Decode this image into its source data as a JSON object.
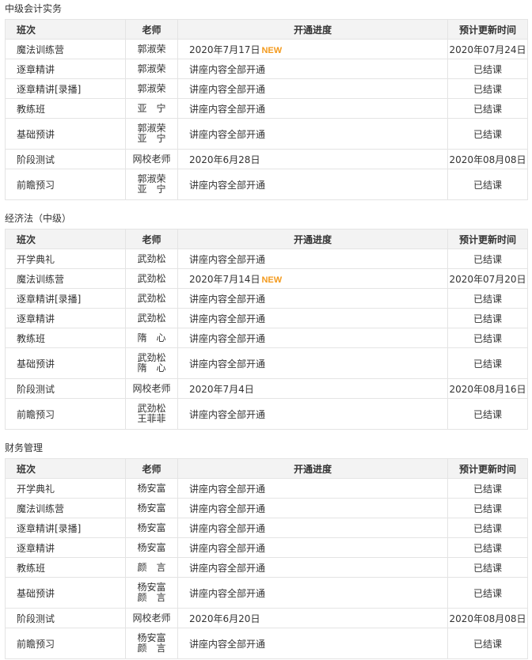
{
  "headers": {
    "name": "班次",
    "teacher": "老师",
    "progress": "开通进度",
    "update": "预计更新时间"
  },
  "sections": [
    {
      "title": "中级会计实务",
      "rows": [
        {
          "name": "魔法训练营",
          "teachers": [
            "郭淑荣"
          ],
          "progress": "2020年7月17日",
          "badge": "NEW",
          "update": "2020年07月24日"
        },
        {
          "name": "逐章精讲",
          "teachers": [
            "郭淑荣"
          ],
          "progress": "讲座内容全部开通",
          "badge": "",
          "update": "已结课"
        },
        {
          "name": "逐章精讲[录播]",
          "teachers": [
            "郭淑荣"
          ],
          "progress": "讲座内容全部开通",
          "badge": "",
          "update": "已结课"
        },
        {
          "name": "教练班",
          "teachers": [
            "亚　宁"
          ],
          "progress": "讲座内容全部开通",
          "badge": "",
          "update": "已结课"
        },
        {
          "name": "基础预讲",
          "teachers": [
            "郭淑荣",
            "亚　宁"
          ],
          "progress": "讲座内容全部开通",
          "badge": "",
          "update": "已结课"
        },
        {
          "name": "阶段测试",
          "teachers": [
            "网校老师"
          ],
          "progress": "2020年6月28日",
          "badge": "",
          "update": "2020年08月08日"
        },
        {
          "name": "前瞻预习",
          "teachers": [
            "郭淑荣",
            "亚　宁"
          ],
          "progress": "讲座内容全部开通",
          "badge": "",
          "update": "已结课"
        }
      ]
    },
    {
      "title": "经济法（中级）",
      "rows": [
        {
          "name": "开学典礼",
          "teachers": [
            "武劲松"
          ],
          "progress": "讲座内容全部开通",
          "badge": "",
          "update": "已结课"
        },
        {
          "name": "魔法训练营",
          "teachers": [
            "武劲松"
          ],
          "progress": "2020年7月14日",
          "badge": "NEW",
          "update": "2020年07月20日"
        },
        {
          "name": "逐章精讲[录播]",
          "teachers": [
            "武劲松"
          ],
          "progress": "讲座内容全部开通",
          "badge": "",
          "update": "已结课"
        },
        {
          "name": "逐章精讲",
          "teachers": [
            "武劲松"
          ],
          "progress": "讲座内容全部开通",
          "badge": "",
          "update": "已结课"
        },
        {
          "name": "教练班",
          "teachers": [
            "隋　心"
          ],
          "progress": "讲座内容全部开通",
          "badge": "",
          "update": "已结课"
        },
        {
          "name": "基础预讲",
          "teachers": [
            "武劲松",
            "隋　心"
          ],
          "progress": "讲座内容全部开通",
          "badge": "",
          "update": "已结课"
        },
        {
          "name": "阶段测试",
          "teachers": [
            "网校老师"
          ],
          "progress": "2020年7月4日",
          "badge": "",
          "update": "2020年08月16日"
        },
        {
          "name": "前瞻预习",
          "teachers": [
            "武劲松",
            "王菲菲"
          ],
          "progress": "讲座内容全部开通",
          "badge": "",
          "update": "已结课"
        }
      ]
    },
    {
      "title": "财务管理",
      "rows": [
        {
          "name": "开学典礼",
          "teachers": [
            "杨安富"
          ],
          "progress": "讲座内容全部开通",
          "badge": "",
          "update": "已结课"
        },
        {
          "name": "魔法训练营",
          "teachers": [
            "杨安富"
          ],
          "progress": "讲座内容全部开通",
          "badge": "",
          "update": "已结课"
        },
        {
          "name": "逐章精讲[录播]",
          "teachers": [
            "杨安富"
          ],
          "progress": "讲座内容全部开通",
          "badge": "",
          "update": "已结课"
        },
        {
          "name": "逐章精讲",
          "teachers": [
            "杨安富"
          ],
          "progress": "讲座内容全部开通",
          "badge": "",
          "update": "已结课"
        },
        {
          "name": "教练班",
          "teachers": [
            "颜　言"
          ],
          "progress": "讲座内容全部开通",
          "badge": "",
          "update": "已结课"
        },
        {
          "name": "基础预讲",
          "teachers": [
            "杨安富",
            "颜　言"
          ],
          "progress": "讲座内容全部开通",
          "badge": "",
          "update": "已结课"
        },
        {
          "name": "阶段测试",
          "teachers": [
            "网校老师"
          ],
          "progress": "2020年6月20日",
          "badge": "",
          "update": "2020年08月08日"
        },
        {
          "name": "前瞻预习",
          "teachers": [
            "杨安富",
            "颜　言"
          ],
          "progress": "讲座内容全部开通",
          "badge": "",
          "update": "已结课"
        }
      ]
    }
  ]
}
